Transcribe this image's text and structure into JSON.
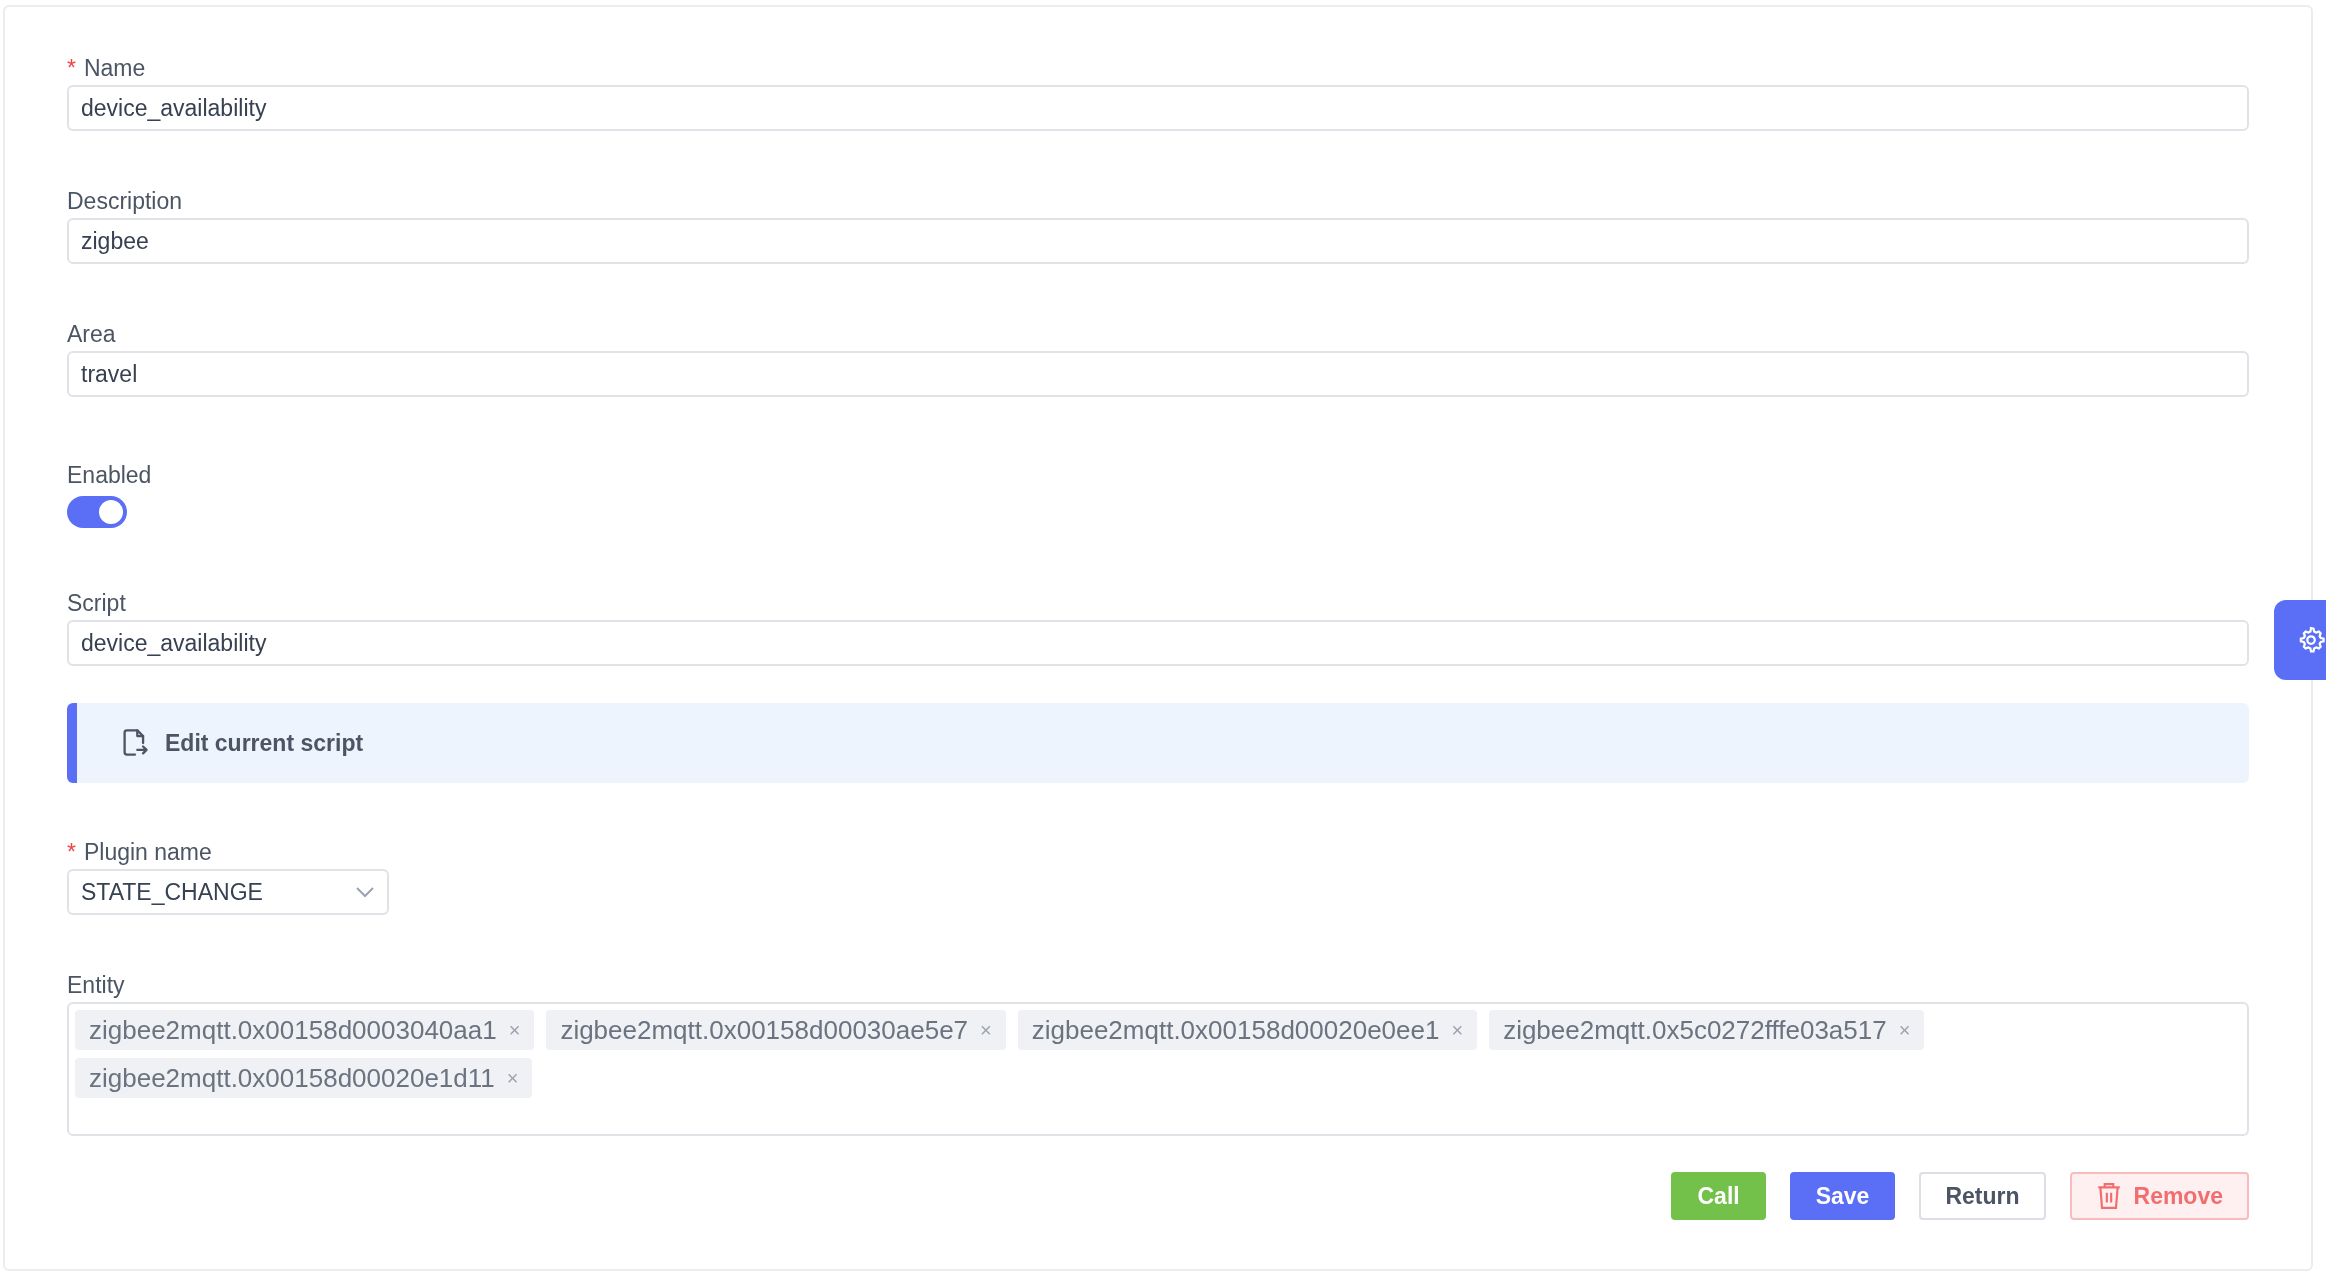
{
  "fields": [
    {
      "kind": "text",
      "label": "Name",
      "required": true,
      "value": "device_availability"
    },
    {
      "kind": "text",
      "label": "Description",
      "required": false,
      "value": "zigbee"
    },
    {
      "kind": "text",
      "label": "Area",
      "required": false,
      "value": "travel"
    },
    {
      "kind": "switch",
      "label": "Enabled",
      "required": false,
      "on": true
    },
    {
      "kind": "text",
      "label": "Script",
      "required": false,
      "value": "device_availability"
    },
    {
      "kind": "link",
      "label": "Edit current script"
    },
    {
      "kind": "select",
      "label": "Plugin name",
      "required": true,
      "value": "STATE_CHANGE"
    },
    {
      "kind": "tags",
      "label": "Entity",
      "required": false,
      "tags": [
        "zigbee2mqtt.0x00158d0003040aa1",
        "zigbee2mqtt.0x00158d00030ae5e7",
        "zigbee2mqtt.0x00158d00020e0ee1",
        "zigbee2mqtt.0x5c0272fffe03a517",
        "zigbee2mqtt.0x00158d00020e1d11"
      ]
    }
  ],
  "required_mark": "*",
  "tag_remove": "×",
  "buttons": [
    {
      "kind": "success",
      "label": "Call"
    },
    {
      "kind": "primary",
      "label": "Save"
    },
    {
      "kind": "default",
      "label": "Return"
    },
    {
      "kind": "danger",
      "label": "Remove"
    }
  ]
}
